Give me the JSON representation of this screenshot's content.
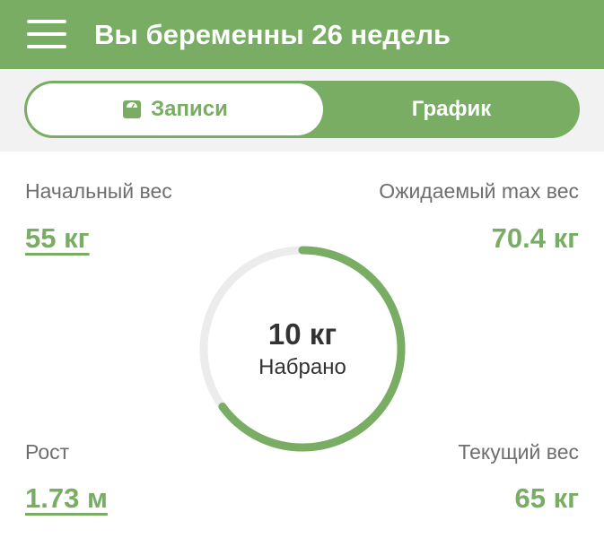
{
  "header": {
    "title": "Вы беременны 26 недель",
    "menu_icon": "hamburger-menu-icon"
  },
  "tabs": {
    "records_label": "Записи",
    "records_icon": "scale-icon",
    "chart_label": "График",
    "active": "records"
  },
  "stats": {
    "start_weight_label": "Начальный вес",
    "start_weight_value": "55 кг",
    "expected_max_label": "Ожидаемый max вес",
    "expected_max_value": "70.4 кг",
    "height_label": "Рост",
    "height_value": "1.73 м",
    "current_weight_label": "Текущий вес",
    "current_weight_value": "65 кг"
  },
  "gain_ring": {
    "value_text": "10 кг",
    "caption": "Набрано",
    "fraction": 0.65
  },
  "colors": {
    "accent": "#78ad63",
    "ring_track": "#ececec",
    "label_text": "#6e6e6e",
    "center_text": "#333333",
    "segment_bg": "#f2f2f2"
  }
}
